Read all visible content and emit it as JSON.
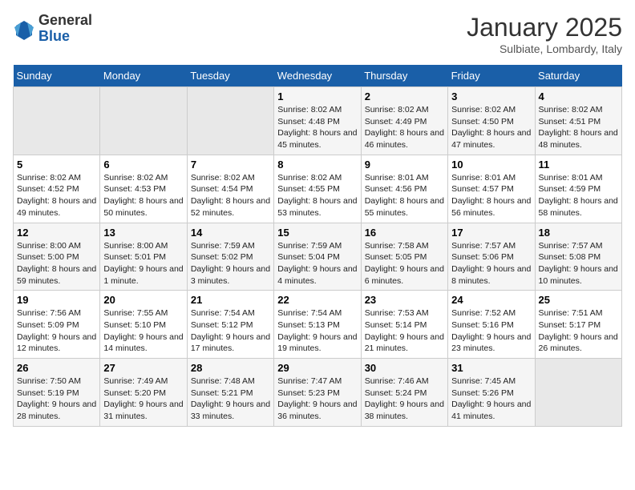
{
  "logo": {
    "general": "General",
    "blue": "Blue"
  },
  "header": {
    "month": "January 2025",
    "location": "Sulbiate, Lombardy, Italy"
  },
  "weekdays": [
    "Sunday",
    "Monday",
    "Tuesday",
    "Wednesday",
    "Thursday",
    "Friday",
    "Saturday"
  ],
  "weeks": [
    [
      {
        "day": "",
        "empty": true
      },
      {
        "day": "",
        "empty": true
      },
      {
        "day": "",
        "empty": true
      },
      {
        "day": "1",
        "sunrise": "8:02 AM",
        "sunset": "4:48 PM",
        "daylight": "8 hours and 45 minutes."
      },
      {
        "day": "2",
        "sunrise": "8:02 AM",
        "sunset": "4:49 PM",
        "daylight": "8 hours and 46 minutes."
      },
      {
        "day": "3",
        "sunrise": "8:02 AM",
        "sunset": "4:50 PM",
        "daylight": "8 hours and 47 minutes."
      },
      {
        "day": "4",
        "sunrise": "8:02 AM",
        "sunset": "4:51 PM",
        "daylight": "8 hours and 48 minutes."
      }
    ],
    [
      {
        "day": "5",
        "sunrise": "8:02 AM",
        "sunset": "4:52 PM",
        "daylight": "8 hours and 49 minutes."
      },
      {
        "day": "6",
        "sunrise": "8:02 AM",
        "sunset": "4:53 PM",
        "daylight": "8 hours and 50 minutes."
      },
      {
        "day": "7",
        "sunrise": "8:02 AM",
        "sunset": "4:54 PM",
        "daylight": "8 hours and 52 minutes."
      },
      {
        "day": "8",
        "sunrise": "8:02 AM",
        "sunset": "4:55 PM",
        "daylight": "8 hours and 53 minutes."
      },
      {
        "day": "9",
        "sunrise": "8:01 AM",
        "sunset": "4:56 PM",
        "daylight": "8 hours and 55 minutes."
      },
      {
        "day": "10",
        "sunrise": "8:01 AM",
        "sunset": "4:57 PM",
        "daylight": "8 hours and 56 minutes."
      },
      {
        "day": "11",
        "sunrise": "8:01 AM",
        "sunset": "4:59 PM",
        "daylight": "8 hours and 58 minutes."
      }
    ],
    [
      {
        "day": "12",
        "sunrise": "8:00 AM",
        "sunset": "5:00 PM",
        "daylight": "8 hours and 59 minutes."
      },
      {
        "day": "13",
        "sunrise": "8:00 AM",
        "sunset": "5:01 PM",
        "daylight": "9 hours and 1 minute."
      },
      {
        "day": "14",
        "sunrise": "7:59 AM",
        "sunset": "5:02 PM",
        "daylight": "9 hours and 3 minutes."
      },
      {
        "day": "15",
        "sunrise": "7:59 AM",
        "sunset": "5:04 PM",
        "daylight": "9 hours and 4 minutes."
      },
      {
        "day": "16",
        "sunrise": "7:58 AM",
        "sunset": "5:05 PM",
        "daylight": "9 hours and 6 minutes."
      },
      {
        "day": "17",
        "sunrise": "7:57 AM",
        "sunset": "5:06 PM",
        "daylight": "9 hours and 8 minutes."
      },
      {
        "day": "18",
        "sunrise": "7:57 AM",
        "sunset": "5:08 PM",
        "daylight": "9 hours and 10 minutes."
      }
    ],
    [
      {
        "day": "19",
        "sunrise": "7:56 AM",
        "sunset": "5:09 PM",
        "daylight": "9 hours and 12 minutes."
      },
      {
        "day": "20",
        "sunrise": "7:55 AM",
        "sunset": "5:10 PM",
        "daylight": "9 hours and 14 minutes."
      },
      {
        "day": "21",
        "sunrise": "7:54 AM",
        "sunset": "5:12 PM",
        "daylight": "9 hours and 17 minutes."
      },
      {
        "day": "22",
        "sunrise": "7:54 AM",
        "sunset": "5:13 PM",
        "daylight": "9 hours and 19 minutes."
      },
      {
        "day": "23",
        "sunrise": "7:53 AM",
        "sunset": "5:14 PM",
        "daylight": "9 hours and 21 minutes."
      },
      {
        "day": "24",
        "sunrise": "7:52 AM",
        "sunset": "5:16 PM",
        "daylight": "9 hours and 23 minutes."
      },
      {
        "day": "25",
        "sunrise": "7:51 AM",
        "sunset": "5:17 PM",
        "daylight": "9 hours and 26 minutes."
      }
    ],
    [
      {
        "day": "26",
        "sunrise": "7:50 AM",
        "sunset": "5:19 PM",
        "daylight": "9 hours and 28 minutes."
      },
      {
        "day": "27",
        "sunrise": "7:49 AM",
        "sunset": "5:20 PM",
        "daylight": "9 hours and 31 minutes."
      },
      {
        "day": "28",
        "sunrise": "7:48 AM",
        "sunset": "5:21 PM",
        "daylight": "9 hours and 33 minutes."
      },
      {
        "day": "29",
        "sunrise": "7:47 AM",
        "sunset": "5:23 PM",
        "daylight": "9 hours and 36 minutes."
      },
      {
        "day": "30",
        "sunrise": "7:46 AM",
        "sunset": "5:24 PM",
        "daylight": "9 hours and 38 minutes."
      },
      {
        "day": "31",
        "sunrise": "7:45 AM",
        "sunset": "5:26 PM",
        "daylight": "9 hours and 41 minutes."
      },
      {
        "day": "",
        "empty": true
      }
    ]
  ]
}
